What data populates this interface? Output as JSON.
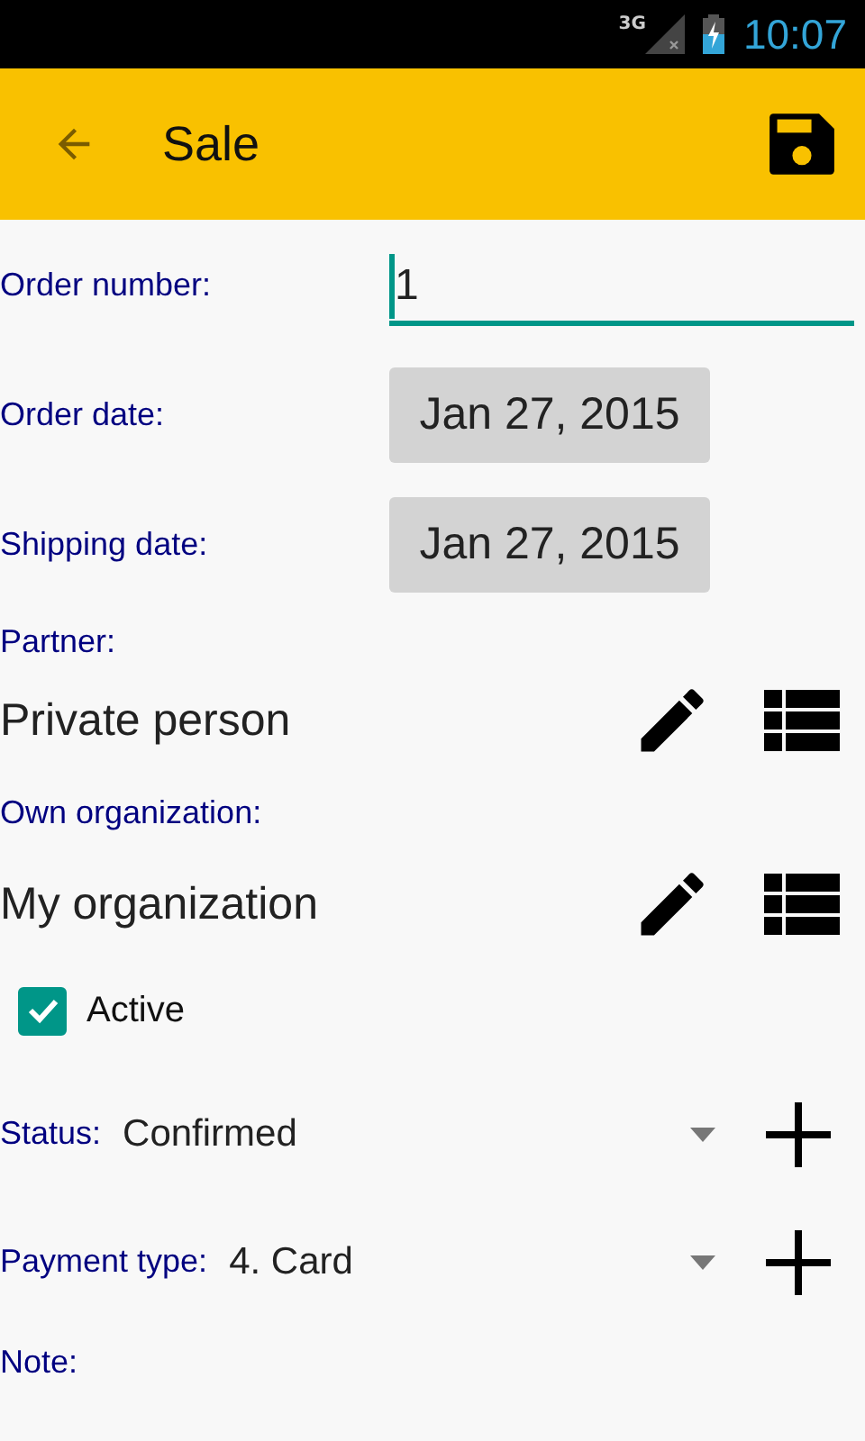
{
  "status_bar": {
    "network": "3G",
    "time": "10:07"
  },
  "app_bar": {
    "title": "Sale"
  },
  "form": [
    {
      "kind": "text",
      "label": "Order number:",
      "value": "1",
      "focused": true
    },
    {
      "kind": "date",
      "label": "Order date:",
      "value": "Jan 27, 2015"
    },
    {
      "kind": "date",
      "label": "Shipping date:",
      "value": "Jan 27, 2015"
    },
    {
      "kind": "heading",
      "label": "Partner:"
    },
    {
      "kind": "reference",
      "value": "Private person"
    },
    {
      "kind": "heading",
      "label": "Own organization:"
    },
    {
      "kind": "reference",
      "value": "My organization"
    },
    {
      "kind": "checkbox",
      "label": "Active",
      "checked": true
    },
    {
      "kind": "select",
      "label": "Status:",
      "value": "Confirmed"
    },
    {
      "kind": "select",
      "label": "Payment type:",
      "value": "4. Card"
    },
    {
      "kind": "heading",
      "label": "Note:"
    }
  ]
}
